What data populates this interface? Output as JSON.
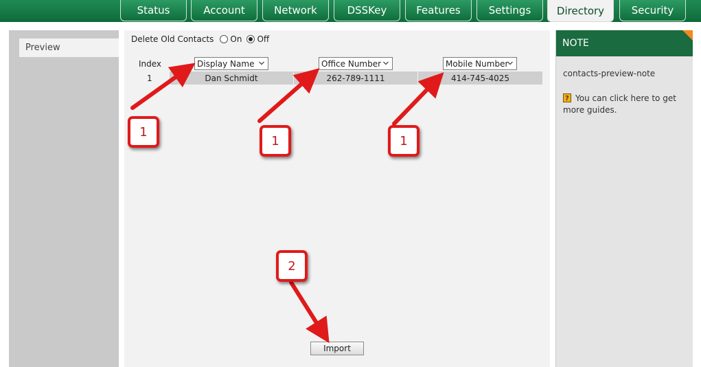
{
  "nav": {
    "tabs": [
      {
        "label": "Status",
        "active": false
      },
      {
        "label": "Account",
        "active": false
      },
      {
        "label": "Network",
        "active": false
      },
      {
        "label": "DSSKey",
        "active": false
      },
      {
        "label": "Features",
        "active": false
      },
      {
        "label": "Settings",
        "active": false
      },
      {
        "label": "Directory",
        "active": true
      },
      {
        "label": "Security",
        "active": false
      }
    ]
  },
  "sidebar": {
    "items": [
      {
        "label": "Preview",
        "selected": true
      }
    ]
  },
  "main": {
    "delete_old_contacts": {
      "label": "Delete Old Contacts",
      "options": [
        "On",
        "Off"
      ],
      "selected": "Off"
    },
    "columns": {
      "index_label": "Index",
      "selects": [
        {
          "value": "Display Name"
        },
        {
          "value": "Office Number"
        },
        {
          "value": "Mobile Number"
        }
      ]
    },
    "rows": [
      {
        "index": "1",
        "display_name": "Dan Schmidt",
        "office_number": "262-789-1111",
        "mobile_number": "414-745-4025"
      }
    ],
    "import_label": "Import"
  },
  "annotations": {
    "callouts": [
      "1",
      "1",
      "1",
      "2"
    ]
  },
  "note": {
    "header": "NOTE",
    "text": "contacts-preview-note",
    "guide": "You can click here to get more guides.",
    "guide_icon": "book-help-icon"
  },
  "colors": {
    "brand_green": "#1a6b3f",
    "accent_orange": "#f08a1c",
    "annotation_red": "#e01a1a"
  }
}
